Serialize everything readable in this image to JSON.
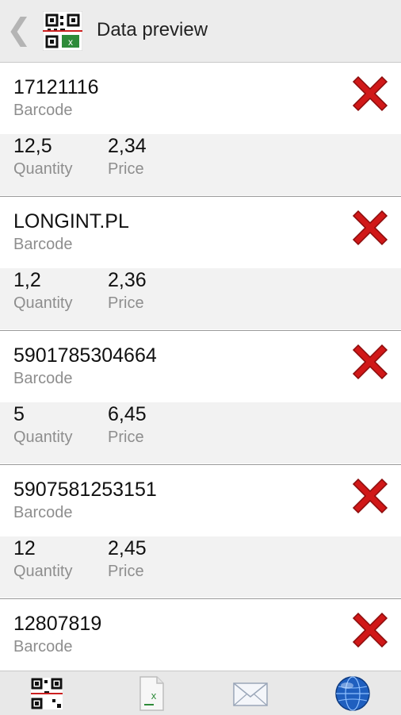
{
  "navbar": {
    "title": "Data preview",
    "back_icon": "chevron-left-icon",
    "logo_icon": "qr-excel-logo-icon"
  },
  "items": [
    {
      "barcode": "17121116",
      "barcode_label": "Barcode",
      "quantity": "12,5",
      "quantity_label": "Quantity",
      "price": "2,34",
      "price_label": "Price"
    },
    {
      "barcode": "LONGINT.PL",
      "barcode_label": "Barcode",
      "quantity": "1,2",
      "quantity_label": "Quantity",
      "price": "2,36",
      "price_label": "Price"
    },
    {
      "barcode": "5901785304664",
      "barcode_label": "Barcode",
      "quantity": "5",
      "quantity_label": "Quantity",
      "price": "6,45",
      "price_label": "Price"
    },
    {
      "barcode": "5907581253151",
      "barcode_label": "Barcode",
      "quantity": "12",
      "quantity_label": "Quantity",
      "price": "2,45",
      "price_label": "Price"
    },
    {
      "barcode": "12807819",
      "barcode_label": "Barcode",
      "quantity": "",
      "quantity_label": "",
      "price": "",
      "price_label": ""
    }
  ],
  "tabbar": {
    "icons": [
      "qr-code-icon",
      "excel-file-icon",
      "mail-icon",
      "globe-icon"
    ]
  },
  "colors": {
    "delete_red": "#d01818",
    "navbar_bg": "#ececec",
    "row_alt_bg": "#f2f2f2",
    "label_gray": "#8e8e8e"
  }
}
